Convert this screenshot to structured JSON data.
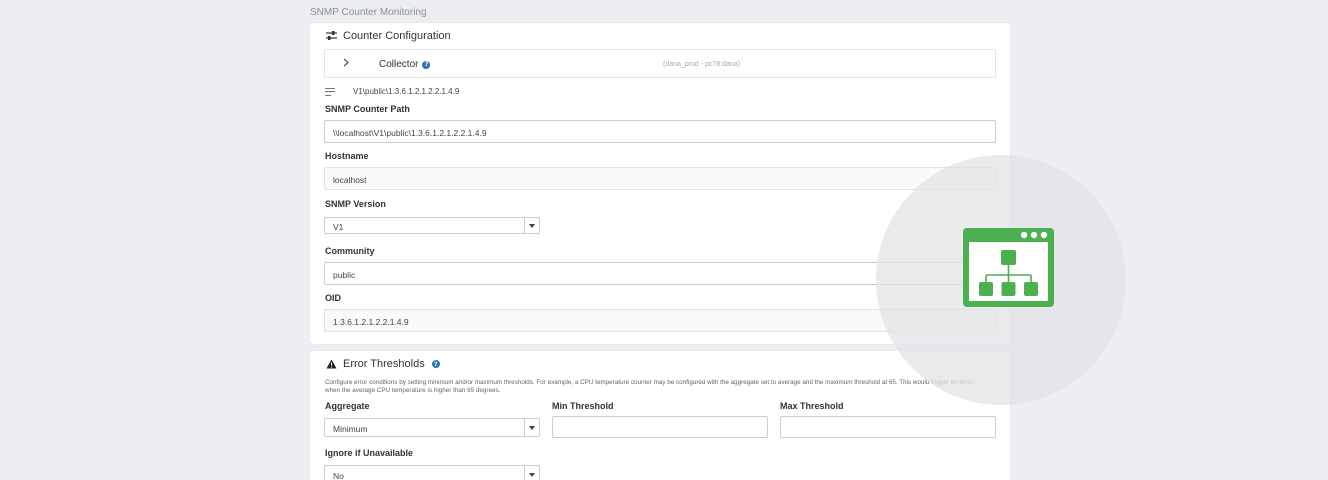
{
  "page": {
    "title": "SNMP Counter Monitoring"
  },
  "config": {
    "header": "Counter Configuration",
    "collector": {
      "label": "Collector",
      "value": "(dana_prod - pc78.dana)"
    },
    "path_display": "V1\\public\\1.3.6.1.2.1.2.2.1.4.9",
    "fields": {
      "path": {
        "label": "SNMP Counter Path",
        "value": "\\\\localhost\\V1\\public\\1.3.6.1.2.1.2.2.1.4.9"
      },
      "hostname": {
        "label": "Hostname",
        "value": "localhost"
      },
      "version": {
        "label": "SNMP Version",
        "value": "V1"
      },
      "community": {
        "label": "Community",
        "value": "public"
      },
      "oid": {
        "label": "OID",
        "value": "1.3.6.1.2.1.2.2.1.4.9"
      }
    }
  },
  "thresholds": {
    "header": "Error Thresholds",
    "description": "Configure error conditions by setting minimum and/or maximum thresholds. For example, a CPU temperature counter may be configured with the aggregate set to average and the maximum threshold at 65. This would trigger an error when the average CPU temperature is higher than 65 degrees.",
    "aggregate": {
      "label": "Aggregate",
      "value": "Minimum"
    },
    "min": {
      "label": "Min Threshold",
      "value": ""
    },
    "max": {
      "label": "Max Threshold",
      "value": ""
    },
    "ignore": {
      "label": "Ignore if Unavailable",
      "value": "No"
    }
  },
  "icons": {
    "config": "sliders-icon",
    "warning": "warning-icon",
    "help": "help-icon",
    "chevron": "chevron-right-icon",
    "path": "lines-icon",
    "app": "network-tree-window-icon"
  },
  "colors": {
    "accent": "#4caf50",
    "help": "#2a73b8"
  }
}
